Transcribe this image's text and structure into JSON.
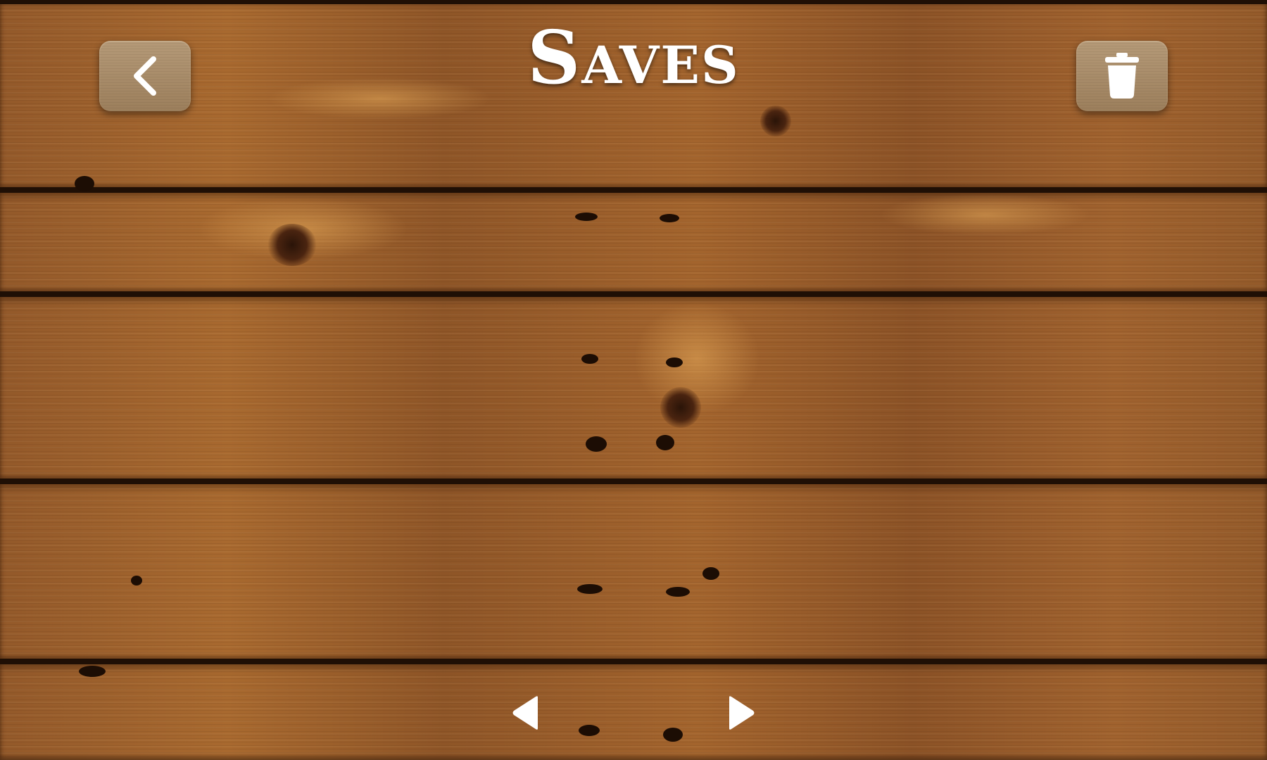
{
  "header": {
    "title": "Saves"
  },
  "buttons": {
    "back_icon": "chevron-left-icon",
    "delete_icon": "trash-icon"
  },
  "pagination": {
    "prev_icon": "triangle-left-icon",
    "next_icon": "triangle-right-icon"
  },
  "colors": {
    "title": "#ffffff",
    "wood": "#8a5426",
    "button_face": "#a88b69"
  }
}
